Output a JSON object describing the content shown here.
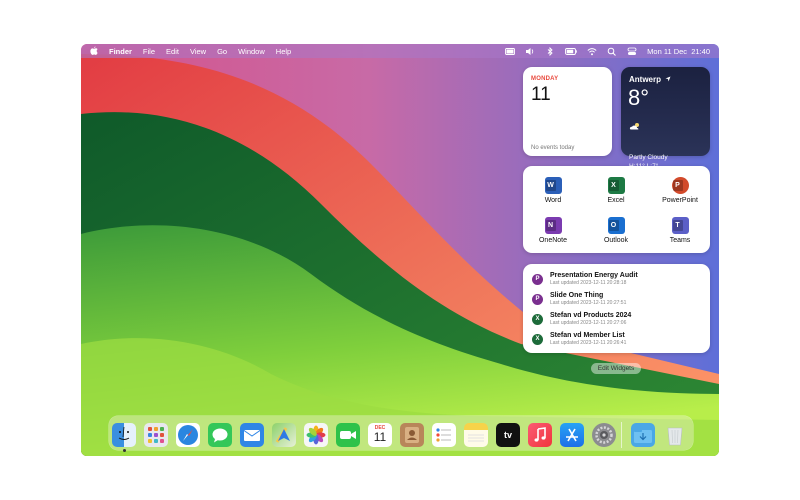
{
  "menubar": {
    "apple_icon": "apple-logo",
    "app_name": "Finder",
    "menus": [
      "File",
      "Edit",
      "View",
      "Go",
      "Window",
      "Help"
    ],
    "status_icons": [
      "battery-icon",
      "volume-icon",
      "bluetooth-icon",
      "battery-level-icon",
      "wifi-icon",
      "search-icon",
      "control-center-icon"
    ],
    "clock": "Mon 11 Dec  21:40"
  },
  "calendar_widget": {
    "day": "MONDAY",
    "date": "11",
    "events": "No events today"
  },
  "weather_widget": {
    "city": "Antwerp",
    "temperature": "8°",
    "condition": "Partly Cloudy",
    "high_low": "H:11° L:7°"
  },
  "apps_widget": {
    "apps": [
      {
        "label": "Word",
        "color": "#2b5fb8",
        "letter": "W"
      },
      {
        "label": "Excel",
        "color": "#1d7a44",
        "letter": "X"
      },
      {
        "label": "PowerPoint",
        "color": "#d24a2b",
        "letter": "P"
      },
      {
        "label": "OneNote",
        "color": "#7b3bb0",
        "letter": "N"
      },
      {
        "label": "Outlook",
        "color": "#1a6fd0",
        "letter": "O"
      },
      {
        "label": "Teams",
        "color": "#5b5fc7",
        "letter": "T"
      }
    ]
  },
  "recent_widget": {
    "files": [
      {
        "badge": "P",
        "badge_color": "#7a2f8f",
        "name": "Presentation Energy Audit",
        "updated": "Last updated 2023-12-11 20:28:18"
      },
      {
        "badge": "P",
        "badge_color": "#7a2f8f",
        "name": "Slide One Thing",
        "updated": "Last updated 2023-12-11 20:27:51"
      },
      {
        "badge": "X",
        "badge_color": "#1d6b3a",
        "name": "Stefan vd Products 2024",
        "updated": "Last updated 2023-12-11 20:27:06"
      },
      {
        "badge": "X",
        "badge_color": "#1d6b3a",
        "name": "Stefan vd Member List",
        "updated": "Last updated 2023-12-11 20:26:41"
      }
    ]
  },
  "edit_widgets_label": "Edit Widgets",
  "dock": {
    "apps": [
      {
        "name": "finder-icon",
        "color": "#3a8fe0"
      },
      {
        "name": "launchpad-icon",
        "color": "#e8e8ee"
      },
      {
        "name": "safari-icon",
        "color": "#2a86e0"
      },
      {
        "name": "messages-icon",
        "color": "#34c759"
      },
      {
        "name": "mail-icon",
        "color": "#2f86e6"
      },
      {
        "name": "maps-icon",
        "color": "#6bbf59"
      },
      {
        "name": "photos-icon",
        "color": "#f6f6f6"
      },
      {
        "name": "facetime-icon",
        "color": "#2ec24a"
      },
      {
        "name": "calendar-icon",
        "color": "#ffffff",
        "text_top": "DEC",
        "text_main": "11"
      },
      {
        "name": "contacts-icon",
        "color": "#b8865a"
      },
      {
        "name": "reminders-icon",
        "color": "#ffffff"
      },
      {
        "name": "notes-icon",
        "color": "#f7d34a"
      },
      {
        "name": "apple-tv-icon",
        "color": "#111111",
        "text_main": "tv"
      },
      {
        "name": "music-icon",
        "color": "#f0454f"
      },
      {
        "name": "app-store-icon",
        "color": "#1e8cf0"
      },
      {
        "name": "system-settings-icon",
        "color": "#8c8c90"
      }
    ],
    "right": [
      {
        "name": "downloads-folder-icon",
        "color": "#4aa7e6"
      },
      {
        "name": "trash-icon",
        "color": "#dfe3e6"
      }
    ]
  }
}
